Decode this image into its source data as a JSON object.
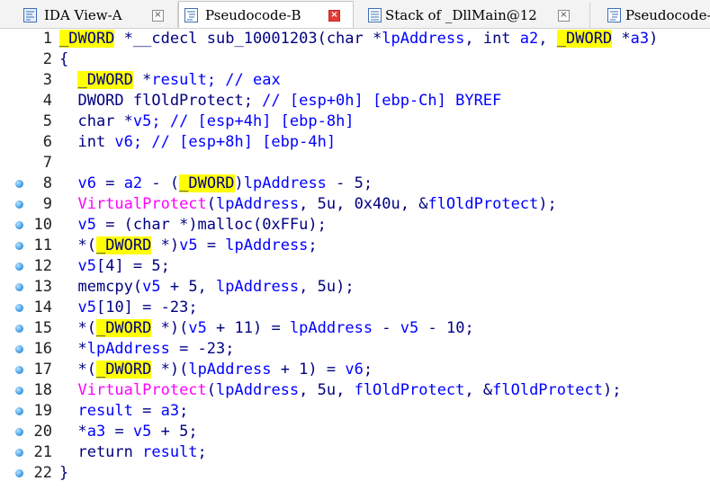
{
  "tabs": [
    {
      "label": "IDA View-A",
      "icon": "disassembly-view-icon",
      "close": "×",
      "active": false
    },
    {
      "label": "Pseudocode-B",
      "icon": "pseudocode-icon",
      "close": "×",
      "active": true
    },
    {
      "label": "Stack of _DllMain@12",
      "icon": "stack-icon",
      "close": "×",
      "active": false
    },
    {
      "label": "Pseudocode-",
      "icon": "pseudocode-icon",
      "close": "",
      "active": false
    }
  ],
  "colors": {
    "highlight": "#ffff00",
    "function_call": "#ff00ff",
    "variable": "#0000ff",
    "comment": "#0000ff",
    "number": "#008000",
    "breakpoint_dot": "#4aa3e8",
    "close_active": "#e53935"
  },
  "code_lines": [
    {
      "num": "1",
      "bp": false,
      "tokens": [
        [
          "_DWORD",
          "hl"
        ],
        [
          " *__cdecl sub_10001203(char *",
          "id"
        ],
        [
          "lpAddress",
          "var"
        ],
        [
          ", int ",
          "id"
        ],
        [
          "a2",
          "var"
        ],
        [
          ", ",
          "id"
        ],
        [
          "_DWORD",
          "hl"
        ],
        [
          " *",
          "id"
        ],
        [
          "a3",
          "var"
        ],
        [
          ")",
          "id"
        ]
      ]
    },
    {
      "num": "2",
      "bp": false,
      "tokens": [
        [
          "{",
          "id"
        ]
      ]
    },
    {
      "num": "3",
      "bp": false,
      "tokens": [
        [
          "  ",
          "id"
        ],
        [
          "_DWORD",
          "hl"
        ],
        [
          " *",
          "id"
        ],
        [
          "result",
          "var"
        ],
        [
          "; // eax",
          "cmt"
        ]
      ]
    },
    {
      "num": "4",
      "bp": false,
      "tokens": [
        [
          "  DWORD flOldProtect; ",
          "id"
        ],
        [
          "// [esp+0h] [ebp-Ch] BYREF",
          "cmt"
        ]
      ]
    },
    {
      "num": "5",
      "bp": false,
      "tokens": [
        [
          "  char *",
          "id"
        ],
        [
          "v5",
          "var"
        ],
        [
          "; // [esp+4h] [ebp-8h]",
          "cmt"
        ]
      ]
    },
    {
      "num": "6",
      "bp": false,
      "tokens": [
        [
          "  int ",
          "id"
        ],
        [
          "v6",
          "var"
        ],
        [
          "; // [esp+8h] [ebp-4h]",
          "cmt"
        ]
      ]
    },
    {
      "num": "7",
      "bp": false,
      "tokens": [
        [
          "",
          "id"
        ]
      ]
    },
    {
      "num": "8",
      "bp": true,
      "tokens": [
        [
          "  ",
          "id"
        ],
        [
          "v6",
          "var"
        ],
        [
          " = ",
          "id"
        ],
        [
          "a2",
          "var"
        ],
        [
          " - (",
          "id"
        ],
        [
          "_DWORD",
          "hl"
        ],
        [
          ")",
          "id"
        ],
        [
          "lpAddress",
          "var"
        ],
        [
          " - 5;",
          "id"
        ]
      ]
    },
    {
      "num": "9",
      "bp": true,
      "tokens": [
        [
          "  ",
          "id"
        ],
        [
          "VirtualProtect",
          "fn"
        ],
        [
          "(",
          "id"
        ],
        [
          "lpAddress",
          "var"
        ],
        [
          ", 5u, 0x40u, &",
          "id"
        ],
        [
          "flOldProtect",
          "var"
        ],
        [
          ");",
          "id"
        ]
      ]
    },
    {
      "num": "10",
      "bp": true,
      "tokens": [
        [
          "  ",
          "id"
        ],
        [
          "v5",
          "var"
        ],
        [
          " = (char *)malloc(0xFFu);",
          "id"
        ]
      ]
    },
    {
      "num": "11",
      "bp": true,
      "tokens": [
        [
          "  *(",
          "id"
        ],
        [
          "_DWORD",
          "hl"
        ],
        [
          " *)",
          "id"
        ],
        [
          "v5",
          "var"
        ],
        [
          " = ",
          "id"
        ],
        [
          "lpAddress",
          "var"
        ],
        [
          ";",
          "id"
        ]
      ]
    },
    {
      "num": "12",
      "bp": true,
      "tokens": [
        [
          "  ",
          "id"
        ],
        [
          "v5",
          "var"
        ],
        [
          "[4] = 5;",
          "id"
        ]
      ]
    },
    {
      "num": "13",
      "bp": true,
      "tokens": [
        [
          "  memcpy(",
          "id"
        ],
        [
          "v5",
          "var"
        ],
        [
          " + 5, ",
          "id"
        ],
        [
          "lpAddress",
          "var"
        ],
        [
          ", 5u);",
          "id"
        ]
      ]
    },
    {
      "num": "14",
      "bp": true,
      "tokens": [
        [
          "  ",
          "id"
        ],
        [
          "v5",
          "var"
        ],
        [
          "[10] = -23;",
          "id"
        ]
      ]
    },
    {
      "num": "15",
      "bp": true,
      "tokens": [
        [
          "  *(",
          "id"
        ],
        [
          "_DWORD",
          "hl"
        ],
        [
          " *)(",
          "id"
        ],
        [
          "v5",
          "var"
        ],
        [
          " + 11) = ",
          "id"
        ],
        [
          "lpAddress",
          "var"
        ],
        [
          " - ",
          "id"
        ],
        [
          "v5",
          "var"
        ],
        [
          " - 10;",
          "id"
        ]
      ]
    },
    {
      "num": "16",
      "bp": true,
      "tokens": [
        [
          "  *",
          "id"
        ],
        [
          "lpAddress",
          "var"
        ],
        [
          " = -23;",
          "id"
        ]
      ]
    },
    {
      "num": "17",
      "bp": true,
      "tokens": [
        [
          "  *(",
          "id"
        ],
        [
          "_DWORD",
          "hl"
        ],
        [
          " *)(",
          "id"
        ],
        [
          "lpAddress",
          "var"
        ],
        [
          " + 1) = ",
          "id"
        ],
        [
          "v6",
          "var"
        ],
        [
          ";",
          "id"
        ]
      ]
    },
    {
      "num": "18",
      "bp": true,
      "tokens": [
        [
          "  ",
          "id"
        ],
        [
          "VirtualProtect",
          "fn"
        ],
        [
          "(",
          "id"
        ],
        [
          "lpAddress",
          "var"
        ],
        [
          ", 5u, ",
          "id"
        ],
        [
          "flOldProtect",
          "var"
        ],
        [
          ", &",
          "id"
        ],
        [
          "flOldProtect",
          "var"
        ],
        [
          ");",
          "id"
        ]
      ]
    },
    {
      "num": "19",
      "bp": true,
      "tokens": [
        [
          "  ",
          "id"
        ],
        [
          "result",
          "var"
        ],
        [
          " = ",
          "id"
        ],
        [
          "a3",
          "var"
        ],
        [
          ";",
          "id"
        ]
      ]
    },
    {
      "num": "20",
      "bp": true,
      "tokens": [
        [
          "  *",
          "id"
        ],
        [
          "a3",
          "var"
        ],
        [
          " = ",
          "id"
        ],
        [
          "v5",
          "var"
        ],
        [
          " + 5;",
          "id"
        ]
      ]
    },
    {
      "num": "21",
      "bp": true,
      "tokens": [
        [
          "  return ",
          "id"
        ],
        [
          "result",
          "var"
        ],
        [
          ";",
          "id"
        ]
      ]
    },
    {
      "num": "22",
      "bp": true,
      "tokens": [
        [
          "}",
          "id"
        ]
      ]
    }
  ]
}
